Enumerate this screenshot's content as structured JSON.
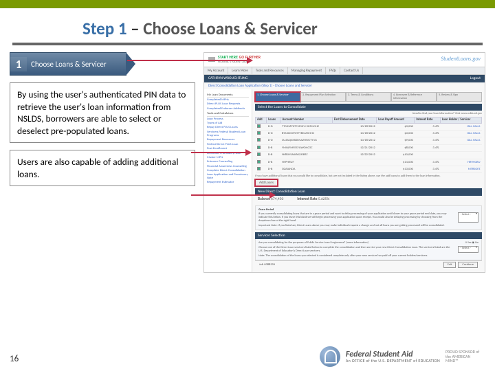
{
  "title": {
    "step": "Step 1",
    "sep": " – ",
    "rest": "Choose Loans & Servicer"
  },
  "pill": {
    "num": "1",
    "label": "Choose Loans & Servicer"
  },
  "callout1": "By using the user's authenticated PIN data to retrieve the user's loan information from NSLDS, borrowers are able to select or deselect pre-populated loans.",
  "callout2": "Users are also capable of adding additional loans.",
  "screenshot": {
    "brand_tagline1": "START HERE",
    "brand_tagline2": "GO FURTHER",
    "brand_sub": "FEDERAL STUDENT AID",
    "brand_right": "StudentLoans.gov",
    "nav": [
      "My Account",
      "Learn More",
      "Tools and Resources",
      "Managing Repayment",
      "FAQs",
      "Contact Us"
    ],
    "user_bar_left": "CATHRYN WROUGHTLING",
    "user_bar_right": "Logout",
    "page_title": "Direct Consolidation Loan Application (Step 1) - Choose Loans and Servicer",
    "stepper": [
      "1. Choose Loans & Servicer",
      "2. Repayment Plan Selection",
      "3. Terms & Conditions",
      "4. Borrower & Reference Information",
      "5. Review & Sign"
    ],
    "sidebar": {
      "groups": [
        {
          "title": "My Loan Documents",
          "items": [
            "Completed MPNs",
            "Direct PLUS Loan Requests",
            "Completed Endorser Addenda"
          ]
        },
        {
          "title": "Tools and Calculators",
          "items": [
            "Loan Process",
            "Types of Aid",
            "Repay Direct PLUS Loans",
            "Servicers Federal Student Loan Programs",
            "Repayment Resources",
            "Federal Direct PLUS Loan",
            "Post Enrollment",
            "Electronic Promissory Note",
            "Master MPN",
            "Entrance Counseling",
            "Financial Awareness Counseling",
            "Complete Direct Consolidation Loan Application and Promissory Note",
            "Repayment Estimator"
          ]
        }
      ]
    },
    "panel1_title": "Select the Loans to Consolidate",
    "panel1_hint": "Need to find your loan information? Visit www.nslds.ed.gov",
    "table": {
      "headers": [
        "Add",
        "Loans",
        "Account Number",
        "First Disbursement Date",
        "Loan Payoff Amount",
        "Interest Rate",
        "Loan Holder / Servicer"
      ],
      "rows": [
        [
          "",
          "D-D",
          "TT0396707CSFS0Y+50594YHE",
          "10/18/2012",
          "$3,000",
          "3.4%",
          "GILL FALLS"
        ],
        [
          "",
          "D-D",
          "89S30CDP097Y8CAFKHHS",
          "10/18/2012",
          "$3,000",
          "3.4%",
          "GILL FALLS"
        ],
        [
          "",
          "D-D",
          "3U3AQAYB2KNAZHWCYY1G",
          "10/18/2012",
          "$9,000",
          "3.4%",
          "GILL FALLS"
        ],
        [
          "",
          "D-B",
          "YMNJFMFESYUWONC5C",
          "12/21/2012",
          "$8,000",
          "3.4%",
          ""
        ],
        [
          "",
          "D-B",
          "9K8SIYSAKI6KZJEB5Z",
          "12/22/2012",
          "$10,000",
          "",
          ""
        ],
        [
          "",
          "D-B",
          "HYPHRUF",
          "",
          "$14,000",
          "3.4%",
          "HRYHGRU"
        ],
        [
          "",
          "D-B",
          "OZAIANDA",
          "",
          "$13,000",
          "3.4%",
          "MTRSOFZ"
        ]
      ]
    },
    "table_note": "If you have additional loans that you would like to consolidate, but are not included in the listing above, use the add loans to add them to the loan information.",
    "add_label": "Add Loans",
    "panel2_title": "New Direct Consolidation Loan",
    "panel2_row": {
      "balance_lbl": "Balance",
      "balance": "$74,450",
      "rate_lbl": "Interest Rate",
      "rate": "5.625%"
    },
    "grace": {
      "title": "Grace Period",
      "body": "If you currently consolidating loans that are in a grace period and want to delay processing of your application until closer to your grace period end date, you may indicate this below. If you leave this blank we will begin processing your application upon receipt. You would also be delaying processing by choosing from the dropdown box at the right hand.",
      "select": "- Select -",
      "note": "Important Note: If you listed any Direct Loans above you may make individual request a change and not all loans you are getting processed will be consolidated."
    },
    "servicer": {
      "title": "Servicer Selection",
      "q": "Are you consolidating for the purposes of Public Service Loan Forgiveness? (more information)",
      "radio1": "Yes",
      "radio2": "No",
      "radio2_state": "checked",
      "body": "Choose one of the Direct Loan servicers listed below to complete the consolidation and then service your new Direct Consolidation Loan. The servicers listed are the U.S. Department of Education's Direct Loan servicers.",
      "note": "Note: The consolidation of the loans you selected is considered complete only after your new servicer has paid off your current holders/servicers.",
      "select": "- Select -"
    },
    "footer": {
      "job": "Job 0388259",
      "exit": "Exit",
      "continue": "Continue"
    }
  },
  "page_number": "16",
  "footer_logo": {
    "main": "Federal Student Aid",
    "sub": "An OFFICE of the U.S. DEPARTMENT of EDUCATION",
    "sponsor": "PROUD SPONSOR of the AMERICAN MIND™"
  }
}
